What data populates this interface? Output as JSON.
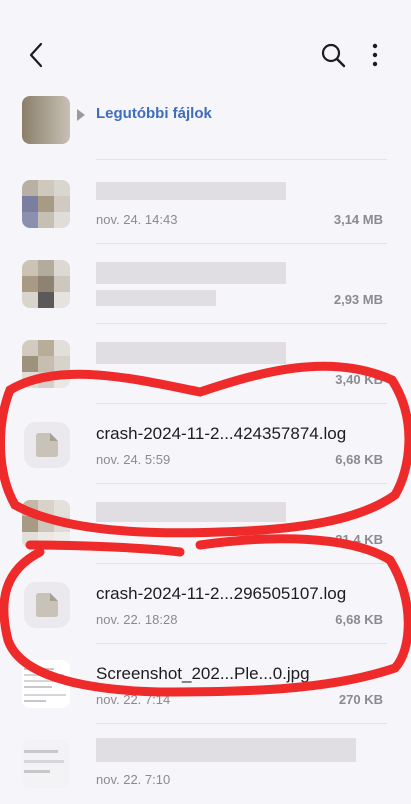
{
  "header": {
    "back_icon": "back-arrow-icon",
    "search_icon": "search-icon",
    "more_icon": "more-vert-icon"
  },
  "breadcrumb": {
    "home_icon": "home-folder-icon",
    "current": "Legutóbbi fájlok"
  },
  "files": [
    {
      "name": "",
      "date": "nov. 24. 14:43",
      "size": "3,14 MB",
      "kind": "image"
    },
    {
      "name": "",
      "date": "",
      "size": "2,93 MB",
      "kind": "image"
    },
    {
      "name": "",
      "date": "",
      "size": "3,40 KB",
      "kind": "image"
    },
    {
      "name": "crash-2024-11-2...424357874.log",
      "date": "nov. 24. 5:59",
      "size": "6,68 KB",
      "kind": "log"
    },
    {
      "name": "",
      "date": "",
      "size": "21,4 KB",
      "kind": "image"
    },
    {
      "name": "crash-2024-11-2...296505107.log",
      "date": "nov. 22. 18:28",
      "size": "6,68 KB",
      "kind": "log"
    },
    {
      "name": "Screenshot_202...Ple...0.jpg",
      "date": "nov. 22. 7:14",
      "size": "270 KB",
      "kind": "image"
    },
    {
      "name": "",
      "date": "nov. 22. 7:10",
      "size": "",
      "kind": "image"
    }
  ],
  "colors": {
    "accent": "#3d6dbd",
    "annotation_red": "#ee2a2a",
    "background": "#f6f5f9"
  }
}
